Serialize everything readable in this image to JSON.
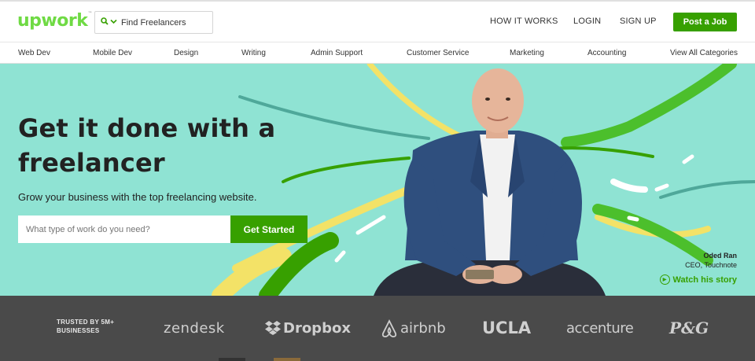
{
  "header": {
    "logo": "upwork",
    "logo_tm": "™",
    "search_label": "Find Freelancers",
    "search_icon": "search-icon",
    "nav": [
      "HOW IT WORKS",
      "LOGIN",
      "SIGN UP"
    ],
    "post_job": "Post a Job"
  },
  "categories": [
    "Web Dev",
    "Mobile Dev",
    "Design",
    "Writing",
    "Admin Support",
    "Customer Service",
    "Marketing",
    "Accounting",
    "View All Categories"
  ],
  "hero": {
    "title": "Get it done with a freelancer",
    "subtitle": "Grow your business with the top freelancing website.",
    "input_placeholder": "What type of work do you need?",
    "cta": "Get Started",
    "person_name": "Oded Ran",
    "person_role": "CEO, Touchnote",
    "watch": "Watch his story"
  },
  "trusted": {
    "label_line1": "TRUSTED BY 5M+",
    "label_line2": "BUSINESSES",
    "brands": [
      "zendesk",
      "Dropbox",
      "airbnb",
      "UCLA",
      "accenture",
      "P&G"
    ]
  },
  "colors": {
    "brand_green": "#37a000",
    "logo_green": "#6fda44",
    "hero_bg": "#8fe3d3",
    "trusted_bg": "#4a4a4a"
  }
}
